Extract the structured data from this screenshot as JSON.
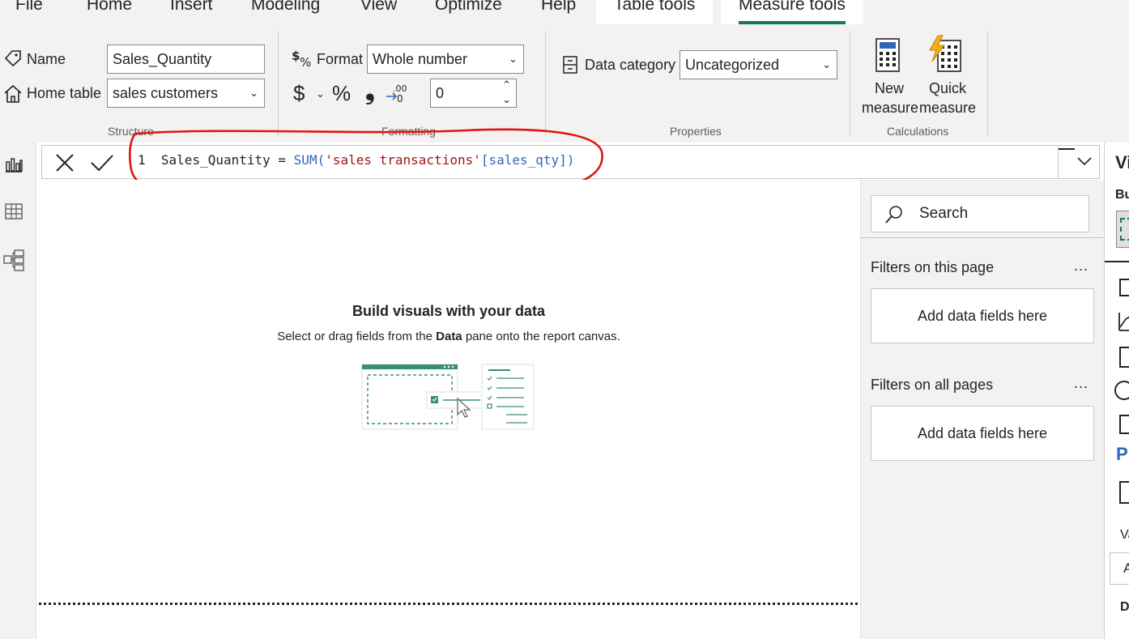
{
  "menu": {
    "tabs": [
      "File",
      "Home",
      "Insert",
      "Modeling",
      "View",
      "Optimize",
      "Help"
    ],
    "context_tabs": [
      "Table tools",
      "Measure tools"
    ],
    "active_tab": "Measure tools"
  },
  "ribbon": {
    "structure": {
      "group_label": "Structure",
      "name_label": "Name",
      "name_value": "Sales_Quantity",
      "home_table_label": "Home table",
      "home_table_value": "sales customers"
    },
    "formatting": {
      "group_label": "Formatting",
      "format_label": "Format",
      "format_value": "Whole number",
      "currency_symbol": "$",
      "percent_symbol": "%",
      "comma_symbol": "❟",
      "decimal_value": "0"
    },
    "properties": {
      "group_label": "Properties",
      "data_category_label": "Data category",
      "data_category_value": "Uncategorized"
    },
    "calculations": {
      "group_label": "Calculations",
      "new_measure_line1": "New",
      "new_measure_line2": "measure",
      "quick_measure_line1": "Quick",
      "quick_measure_line2": "measure"
    }
  },
  "formula_bar": {
    "line_number": "1",
    "measure_name": "Sales_Quantity",
    "operator": " = ",
    "function": "SUM(",
    "table_ref": "'sales transactions'",
    "column_ref": "[sales_qty]",
    "close": ")"
  },
  "canvas": {
    "empty_title": "Build visuals with your data",
    "empty_sub_pre": "Select or drag fields from the ",
    "empty_sub_bold": "Data",
    "empty_sub_post": " pane onto the report canvas."
  },
  "filters": {
    "search_placeholder": "Search",
    "this_page_label": "Filters on this page",
    "this_page_drop": "Add data fields here",
    "all_pages_label": "Filters on all pages",
    "all_pages_drop": "Add data fields here",
    "more": "..."
  },
  "viz_pane": {
    "title_fragment": "Vi",
    "build_fragment": "Bu",
    "values_fragment": "Va",
    "values_input_fragment": "A",
    "drill_fragment": "D"
  },
  "colors": {
    "accent": "#117865",
    "annotation": "#e0140f",
    "dax_function": "#3165bb",
    "dax_string": "#a31515"
  }
}
